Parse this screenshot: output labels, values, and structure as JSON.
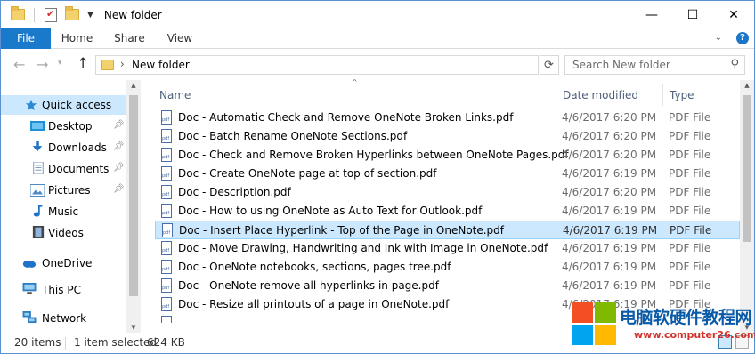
{
  "window": {
    "title": "New folder",
    "controls": {
      "minimize": "—",
      "maximize": "☐",
      "close": "✕"
    }
  },
  "ribbon": {
    "tabs": [
      "File",
      "Home",
      "Share",
      "View"
    ],
    "help": "?"
  },
  "nav": {
    "address_path": "New folder",
    "search_placeholder": "Search New folder"
  },
  "sidebar": {
    "items": [
      {
        "label": "Quick access",
        "icon": "star-icon",
        "color": "#2a8ad4"
      },
      {
        "label": "Desktop",
        "icon": "desktop-icon",
        "color": "#1e90d6"
      },
      {
        "label": "Downloads",
        "icon": "download-arrow-icon",
        "color": "#1e73c9"
      },
      {
        "label": "Documents",
        "icon": "documents-icon",
        "color": "#6f8fb5"
      },
      {
        "label": "Pictures",
        "icon": "pictures-icon",
        "color": "#4f8ac4"
      },
      {
        "label": "Music",
        "icon": "music-note-icon",
        "color": "#1e73c9"
      },
      {
        "label": "Videos",
        "icon": "film-icon",
        "color": "#444444"
      },
      {
        "label": "OneDrive",
        "icon": "cloud-icon",
        "color": "#1e73c9"
      },
      {
        "label": "This PC",
        "icon": "computer-icon",
        "color": "#2f7fc1"
      },
      {
        "label": "Network",
        "icon": "network-icon",
        "color": "#2f7fc1"
      }
    ]
  },
  "columns": {
    "name": "Name",
    "date": "Date modified",
    "type": "Type"
  },
  "files": [
    {
      "name": "Doc - Automatic Check and Remove OneNote Broken Links.pdf",
      "date": "4/6/2017 6:20 PM",
      "type": "PDF File"
    },
    {
      "name": "Doc - Batch Rename OneNote Sections.pdf",
      "date": "4/6/2017 6:20 PM",
      "type": "PDF File"
    },
    {
      "name": "Doc - Check and Remove Broken Hyperlinks between OneNote Pages.pdf",
      "date": "4/6/2017 6:20 PM",
      "type": "PDF File"
    },
    {
      "name": "Doc - Create OneNote page at top of section.pdf",
      "date": "4/6/2017 6:19 PM",
      "type": "PDF File"
    },
    {
      "name": "Doc - Description.pdf",
      "date": "4/6/2017 6:20 PM",
      "type": "PDF File"
    },
    {
      "name": "Doc - How to using OneNote as Auto Text for Outlook.pdf",
      "date": "4/6/2017 6:19 PM",
      "type": "PDF File"
    },
    {
      "name": "Doc - Insert Place Hyperlink - Top of the Page in OneNote.pdf",
      "date": "4/6/2017 6:19 PM",
      "type": "PDF File"
    },
    {
      "name": "Doc - Move Drawing, Handwriting and Ink with Image in OneNote.pdf",
      "date": "4/6/2017 6:19 PM",
      "type": "PDF File"
    },
    {
      "name": "Doc - OneNote notebooks, sections, pages tree.pdf",
      "date": "4/6/2017 6:19 PM",
      "type": "PDF File"
    },
    {
      "name": "Doc - OneNote remove all hyperlinks in page.pdf",
      "date": "4/6/2017 6:19 PM",
      "type": "PDF File"
    },
    {
      "name": "Doc - Resize all printouts of a page in OneNote.pdf",
      "date": "4/6/2017 6:19 PM",
      "type": "PDF File"
    }
  ],
  "status": {
    "count": "20 items",
    "selected": "1 item selected",
    "size": "624 KB"
  },
  "watermark": {
    "title": "电脑软硬件教程网",
    "url": "www.computer26.com"
  },
  "colors": {
    "accent": "#1979ca",
    "selection": "#cce8ff",
    "folder": "#f3d26e"
  }
}
